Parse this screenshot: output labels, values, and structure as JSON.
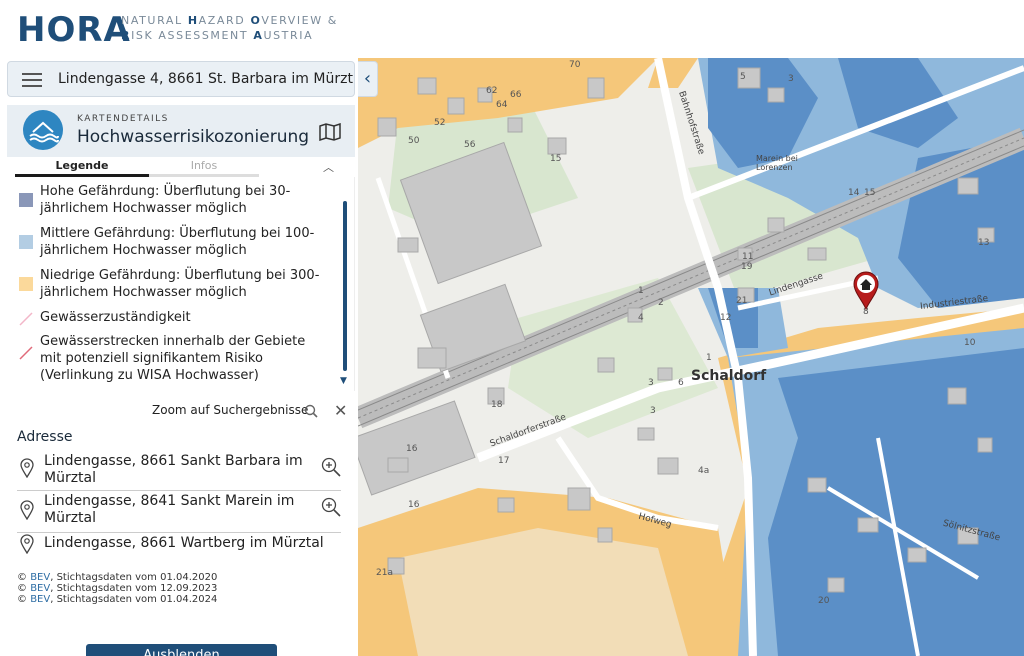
{
  "header": {
    "logo": "HORA",
    "subtitle_line1": "NATURAL HAZARD OVERVIEW &",
    "subtitle_line2": "RISK ASSESSMENT AUSTRIA"
  },
  "search": {
    "value": "Lindengasse 4, 8661 St. Barbara im Mürzt"
  },
  "details": {
    "kicker": "KARTENDETAILS",
    "title": "Hochwasserrisikozonierung",
    "icon": "flood-waves-icon"
  },
  "tabs": [
    {
      "label": "Legende",
      "active": true
    },
    {
      "label": "Infos",
      "active": false
    }
  ],
  "legend": [
    {
      "text": "Hohe Gefährdung: Überflutung bei 30-jährlichem Hochwasser möglich",
      "color": "#8a97b8"
    },
    {
      "text": "Mittlere Gefährdung: Überflutung bei 100-jährlichem Hochwasser möglich",
      "color": "#b3cde3"
    },
    {
      "text": "Niedrige Gefährdung: Überflutung bei 300-jährlichem Hochwasser möglich",
      "color": "#fbd99b"
    },
    {
      "text": "Gewässerzuständigkeit",
      "color": "#f3b6c8"
    },
    {
      "text": "Gewässerstrecken innerhalb der Gebiete mit potenziell signifikantem Risiko (Verlinkung zu WISA Hochwasser)",
      "color": "#e06a7a"
    }
  ],
  "results": {
    "zoom_label": "Zoom auf Suchergebnisse",
    "heading": "Adresse",
    "items": [
      {
        "text": "Lindengasse, 8661 Sankt Barbara im Mürztal"
      },
      {
        "text": "Lindengasse, 8641 Sankt Marein im Mürztal"
      },
      {
        "text": "Lindengasse, 8661 Wartberg im Mürztal"
      }
    ]
  },
  "credits": [
    {
      "link": "BEV",
      "text": ", Stichtagsdaten vom 01.04.2020"
    },
    {
      "link": "BEV",
      "text": ", Stichtagsdaten vom 12.09.2023"
    },
    {
      "link": "BEV",
      "text": ", Stichtagsdaten vom 01.04.2024"
    }
  ],
  "hide_button": "Ausblenden",
  "map": {
    "place": "Schaldorf",
    "streets": {
      "schaldorfer": "Schaldorferstraße",
      "industrie": "Industriestraße",
      "linden": "Lindengasse",
      "hof": "Hofweg",
      "bahnhof": "Bahnhofstraße",
      "solnitz": "Sölnitzstraße"
    },
    "marein": "Marein bei Lorenzen",
    "numbers": [
      "70",
      "62",
      "66",
      "64",
      "52",
      "50",
      "56",
      "15",
      "15",
      "1",
      "2",
      "4",
      "12",
      "10",
      "16",
      "17",
      "18",
      "3",
      "6",
      "4a",
      "1",
      "3",
      "5",
      "8",
      "11",
      "19",
      "21",
      "21a",
      "20",
      "13",
      "3",
      "14",
      "16",
      "6",
      "1",
      "4",
      "8",
      "12"
    ],
    "colors": {
      "blue_high": "#5b8fc7",
      "blue_mid": "#8fb8dc",
      "orange": "#f5c77a",
      "green": "#d8e6cf",
      "road": "#ffffff",
      "accent": "#1f4e79"
    }
  }
}
